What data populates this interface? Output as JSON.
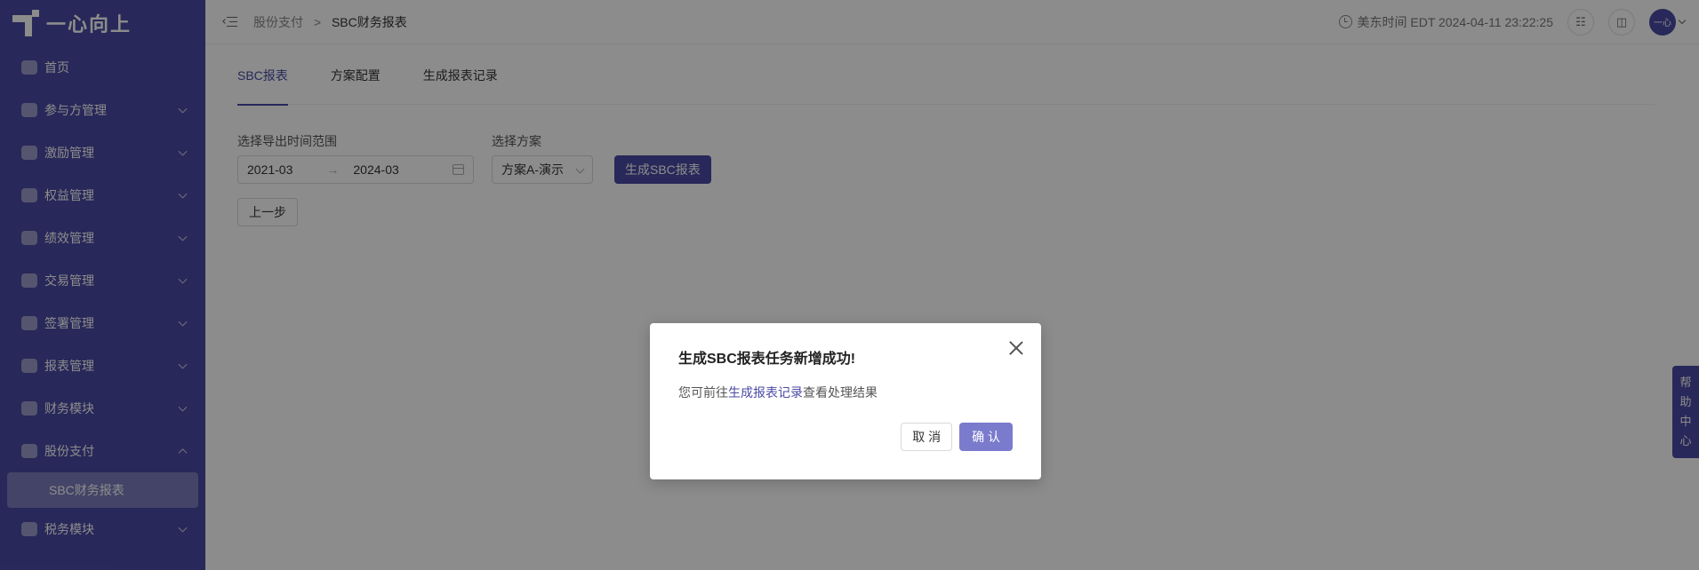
{
  "brand": {
    "name": "一心向上"
  },
  "sidebar": {
    "items": [
      {
        "label": "首页",
        "icon": "home-icon",
        "expandable": false
      },
      {
        "label": "参与方管理",
        "icon": "participants-icon",
        "expandable": true
      },
      {
        "label": "激励管理",
        "icon": "incentive-icon",
        "expandable": true
      },
      {
        "label": "权益管理",
        "icon": "equity-icon",
        "expandable": true
      },
      {
        "label": "绩效管理",
        "icon": "performance-icon",
        "expandable": true
      },
      {
        "label": "交易管理",
        "icon": "trade-icon",
        "expandable": true
      },
      {
        "label": "签署管理",
        "icon": "sign-icon",
        "expandable": true
      },
      {
        "label": "报表管理",
        "icon": "report-icon",
        "expandable": true
      },
      {
        "label": "财务模块",
        "icon": "finance-icon",
        "expandable": true
      },
      {
        "label": "股份支付",
        "icon": "share-payment-icon",
        "expandable": true,
        "expanded": true
      },
      {
        "label": "税务模块",
        "icon": "tax-icon",
        "expandable": true
      }
    ],
    "submenu": {
      "label": "SBC财务报表"
    }
  },
  "header": {
    "breadcrumb_parent": "股份支付",
    "breadcrumb_sep": ">",
    "breadcrumb_current": "SBC财务报表",
    "clock_text": "美东时间 EDT 2024-04-11 23:22:25",
    "avatar_text": "一心"
  },
  "tabs": [
    {
      "label": "SBC报表",
      "active": true
    },
    {
      "label": "方案配置",
      "active": false
    },
    {
      "label": "生成报表记录",
      "active": false
    }
  ],
  "filters": {
    "range_label": "选择导出时间范围",
    "range_start": "2021-03",
    "range_arrow": "→",
    "range_end": "2024-03",
    "plan_label": "选择方案",
    "plan_value": "方案A-演示",
    "generate_button": "生成SBC报表"
  },
  "back_button": "上一步",
  "help": [
    "帮",
    "助",
    "中",
    "心"
  ],
  "modal": {
    "title": "生成SBC报表任务新增成功!",
    "body_prefix": "您可前往",
    "body_link": "生成报表记录",
    "body_suffix": "查看处理结果",
    "cancel": "取 消",
    "confirm": "确 认"
  },
  "colors": {
    "primary": "#4a4aa5",
    "confirm": "#7b7bcd"
  }
}
